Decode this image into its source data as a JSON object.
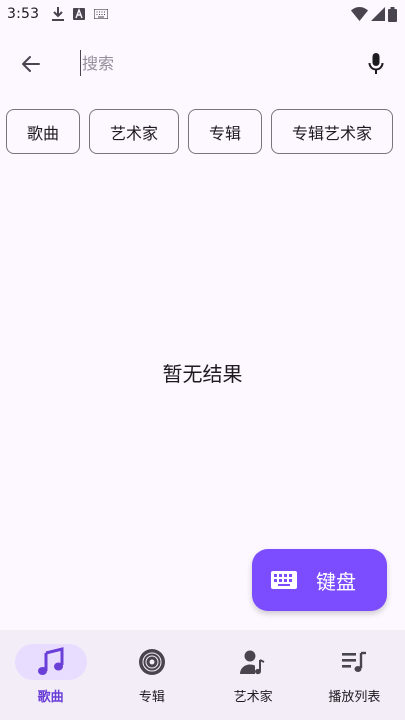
{
  "status_bar": {
    "time": "3:53",
    "left_icons": [
      "download-icon",
      "text-a-icon",
      "keyboard-icon"
    ],
    "right_icons": [
      "wifi-icon",
      "signal-icon",
      "battery-icon"
    ]
  },
  "search": {
    "placeholder": "搜索",
    "value": "",
    "back_icon": "arrow-left-icon",
    "mic_icon": "mic-icon"
  },
  "chips": [
    {
      "label": "歌曲"
    },
    {
      "label": "艺术家"
    },
    {
      "label": "专辑"
    },
    {
      "label": "专辑艺术家"
    }
  ],
  "empty_state": {
    "text": "暂无结果"
  },
  "fab": {
    "label": "键盘",
    "icon": "keyboard-icon"
  },
  "bottom_nav": {
    "items": [
      {
        "label": "歌曲",
        "icon": "music-note-icon",
        "active": true
      },
      {
        "label": "专辑",
        "icon": "album-icon",
        "active": false
      },
      {
        "label": "艺术家",
        "icon": "artist-icon",
        "active": false
      },
      {
        "label": "播放列表",
        "icon": "playlist-icon",
        "active": false
      }
    ]
  },
  "colors": {
    "background": "#fdf7ff",
    "accent": "#7c4dff",
    "nav_background": "#f3edf7",
    "nav_active_pill": "#e8ddff",
    "nav_active_label": "#6a3fd8"
  }
}
